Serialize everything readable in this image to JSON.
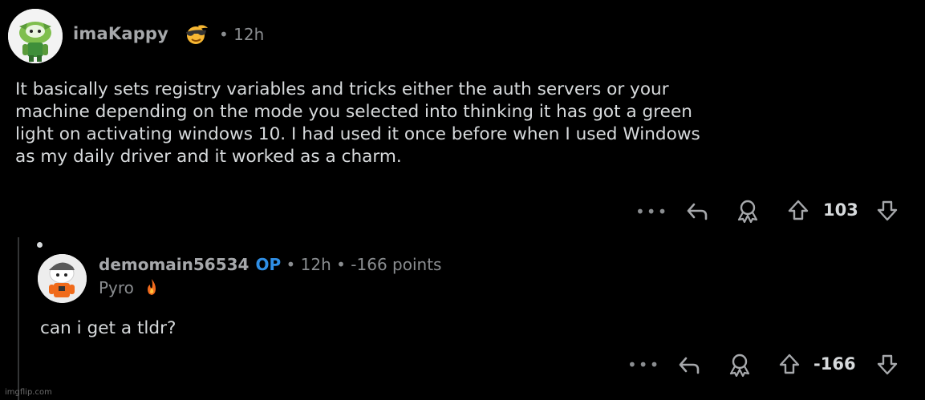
{
  "comments": [
    {
      "username": "imaKappy",
      "meta": "• 12h",
      "body": "It basically sets registry variables and tricks either the auth servers or your\nmachine depending on the mode you selected into thinking it has got a green\nlight on activating windows 10. I had used it once before when I used Windows\nas my daily driver and it worked as a charm.",
      "more_label": "•••",
      "score": "103"
    },
    {
      "username": "demomain56534",
      "op_label": "OP",
      "meta": "• 12h • -166 points",
      "flair": "Pyro",
      "body": "can i get a tldr?",
      "more_label": "•••",
      "score": "-166"
    }
  ],
  "watermark": "imgflip.com",
  "colors": {
    "background": "#000000",
    "op_blue": "#2f8fe6",
    "text": "#d7dadc",
    "meta": "#8a8d90"
  },
  "icons": [
    "reply-icon",
    "award-icon",
    "upvote-icon",
    "downvote-icon",
    "fire-icon",
    "sunglasses-emoji-icon"
  ]
}
